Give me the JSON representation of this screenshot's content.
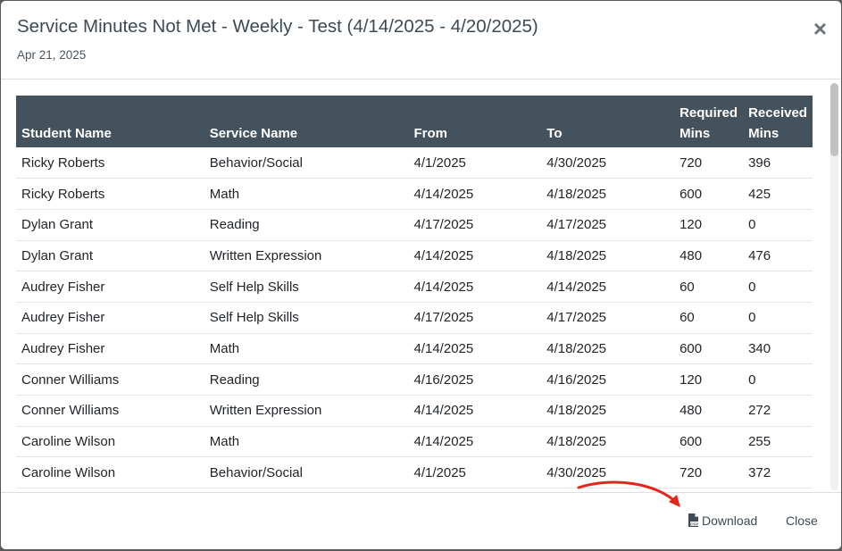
{
  "modal": {
    "title": "Service Minutes Not Met - Weekly - Test (4/14/2025 - 4/20/2025)",
    "subtitle": "Apr 21, 2025",
    "close_glyph": "×"
  },
  "table": {
    "headers": [
      "Student Name",
      "Service Name",
      "From",
      "To",
      "Required Mins",
      "Received Mins"
    ],
    "rows": [
      [
        "Ricky Roberts",
        "Behavior/Social",
        "4/1/2025",
        "4/30/2025",
        "720",
        "396"
      ],
      [
        "Ricky Roberts",
        "Math",
        "4/14/2025",
        "4/18/2025",
        "600",
        "425"
      ],
      [
        "Dylan Grant",
        "Reading",
        "4/17/2025",
        "4/17/2025",
        "120",
        "0"
      ],
      [
        "Dylan Grant",
        "Written Expression",
        "4/14/2025",
        "4/18/2025",
        "480",
        "476"
      ],
      [
        "Audrey Fisher",
        "Self Help Skills",
        "4/14/2025",
        "4/14/2025",
        "60",
        "0"
      ],
      [
        "Audrey Fisher",
        "Self Help Skills",
        "4/17/2025",
        "4/17/2025",
        "60",
        "0"
      ],
      [
        "Audrey Fisher",
        "Math",
        "4/14/2025",
        "4/18/2025",
        "600",
        "340"
      ],
      [
        "Conner Williams",
        "Reading",
        "4/16/2025",
        "4/16/2025",
        "120",
        "0"
      ],
      [
        "Conner Williams",
        "Written Expression",
        "4/14/2025",
        "4/18/2025",
        "480",
        "272"
      ],
      [
        "Caroline Wilson",
        "Math",
        "4/14/2025",
        "4/18/2025",
        "600",
        "255"
      ],
      [
        "Caroline Wilson",
        "Behavior/Social",
        "4/1/2025",
        "4/30/2025",
        "720",
        "372"
      ]
    ]
  },
  "footer": {
    "download_label": "Download",
    "download_icon": "csv-file-icon",
    "close_label": "Close"
  },
  "colors": {
    "header_bg": "#43525d",
    "annotation_arrow": "#e8231c"
  }
}
